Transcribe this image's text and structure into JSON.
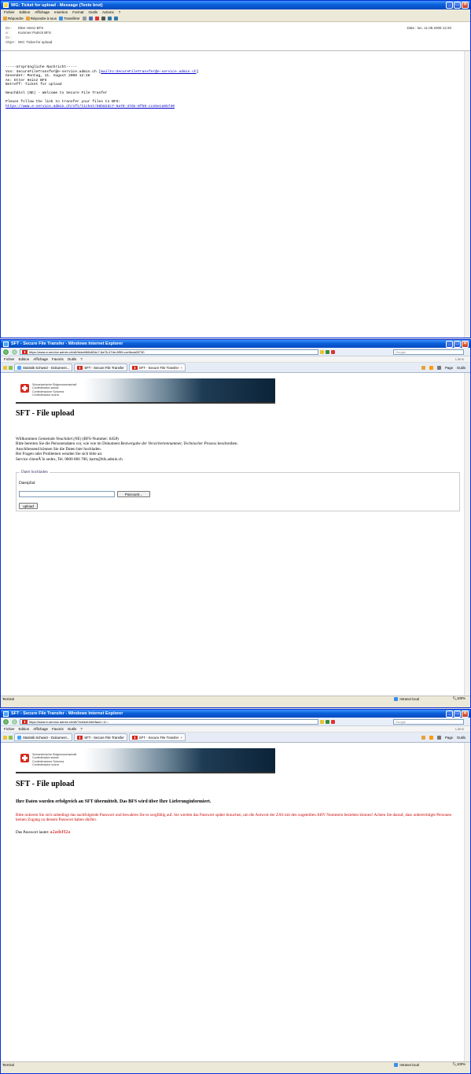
{
  "mail": {
    "title": "WG: Ticket for upload - Message (Texte brut)",
    "menu": [
      "Fichier",
      "Edition",
      "Affichage",
      "Insertion",
      "Format",
      "Outils",
      "Actions",
      "?"
    ],
    "toolbar": [
      "Répondre",
      "Répondre à tous",
      "Transférer"
    ],
    "header": {
      "from_label": "De :",
      "from": "Etter Heinz BFS",
      "to_label": "A :",
      "to": "Kummer Patrick BFS",
      "cc_label": "Cc :",
      "cc": "",
      "subject_label": "Objet :",
      "subject": "WG: Ticket for upload",
      "date_label": "Date :",
      "date": "lun. 11.08.2008 12:20"
    },
    "body": {
      "l1": "-----Ursprüngliche Nachricht-----",
      "l2a": "Von: SecureFileTransfer@e-service.admin.ch [",
      "l2link": "mailto:SecureFileTransfer@e-service.admin.ch",
      "l2b": "]",
      "l3": "Gesendet: Montag, 11. August 2008 12:28",
      "l4": "An: Etter Heinz BFS",
      "l5": "Betreff: Ticket for upload",
      "l6": "Neuchâtel (NE) - Welcome to Secure File Tranfer",
      "l7": "Please follow the link to transfer your files to BFS:",
      "link": "https://www.e-service.admin.ch/sft/ticket/66b82dc7-6a76-47de-8f59-cce5eca65730"
    }
  },
  "ie1": {
    "title": "SFT - Secure File Transfer - Windows Internet Explorer",
    "url": "https://www.e-service.admin.ch/sft/ticket/66b82dc7-6a76-47de-8f59-cce5eca65730",
    "search_placeholder": "Google",
    "menu": [
      "Fichier",
      "Edition",
      "Affichage",
      "Favoris",
      "Outils",
      "?"
    ],
    "links": "Liens",
    "tabs": [
      "Statistik Schweiz - Dokument...",
      "SFT - Secure File Transfer",
      "SFT - Secure File Transfer"
    ],
    "tools": [
      "Page",
      "Outils"
    ],
    "conf_lines": [
      "Schweizerische Eidgenossenschaft",
      "Confédération suisse",
      "Confederazione Svizzera",
      "Confederaziun svizra"
    ],
    "heading": "SFT - File upload",
    "welcome_pre": "Willkommen Gemeinde ",
    "welcome_name": "Neuchâtel (NE)",
    "welcome_mid": " (BFS-Nummer: ",
    "welcome_num": "6458",
    "welcome_post": ")",
    "line2_pre": "Bitte bereiten Sie die Personendaten vor, wie wie im Dokument ",
    "line2_doc": "Bestvergabe der Versichertennummer, Technischer Prozess",
    "line2_post": " beschreiben.",
    "line3": "Anschliessend können Sie die Daten hier hochladen.",
    "line4": "Bei Fragen oder Problemen wenden Sie sich bitte an:",
    "line5": "Service clientÃ¨le sedex, Tel. 0800 866 700, harm@bfs.admin.ch",
    "legend": "Datei hochladen",
    "path_label": "Dateipfad",
    "browse": "Parcourir...",
    "upload": "upload",
    "status": "Terminé",
    "zone": "Intranet local",
    "zoom": "100%"
  },
  "ie2": {
    "title": "SFT - Secure File Transfer - Windows Internet Explorer",
    "url": "https://www.e-service.admin.ch/sft/?wicket:interface=:4::::",
    "heading": "SFT - File upload",
    "success": "Ihre Daten wurden erfolgreich an SFT übermittelt. Das BFS wird über Ihre Lieferunginformiert.",
    "warning": "Bitte notieren Sie sich unbedingt das nachfolgende Passwort und bewahren Sie es sorgfältig auf. Sie werden das Passwort später brauchen, um die Antwort der ZAS mit den zugeteilten AHV Nummern beziehen können! Achten Sie darauf, dass unberechtigte Personen keinen Zugang zu diesem Passwort haben dürfen.",
    "pw_label": "Das Passwort lautet: ",
    "pw": "a2adsH2a",
    "status": "Terminé",
    "zone": "Intranet local",
    "zoom": "100%"
  },
  "colors": {
    "xp_blue": "#0a5fd8",
    "warning_red": "#cc0000",
    "link_blue": "#0000cc"
  }
}
